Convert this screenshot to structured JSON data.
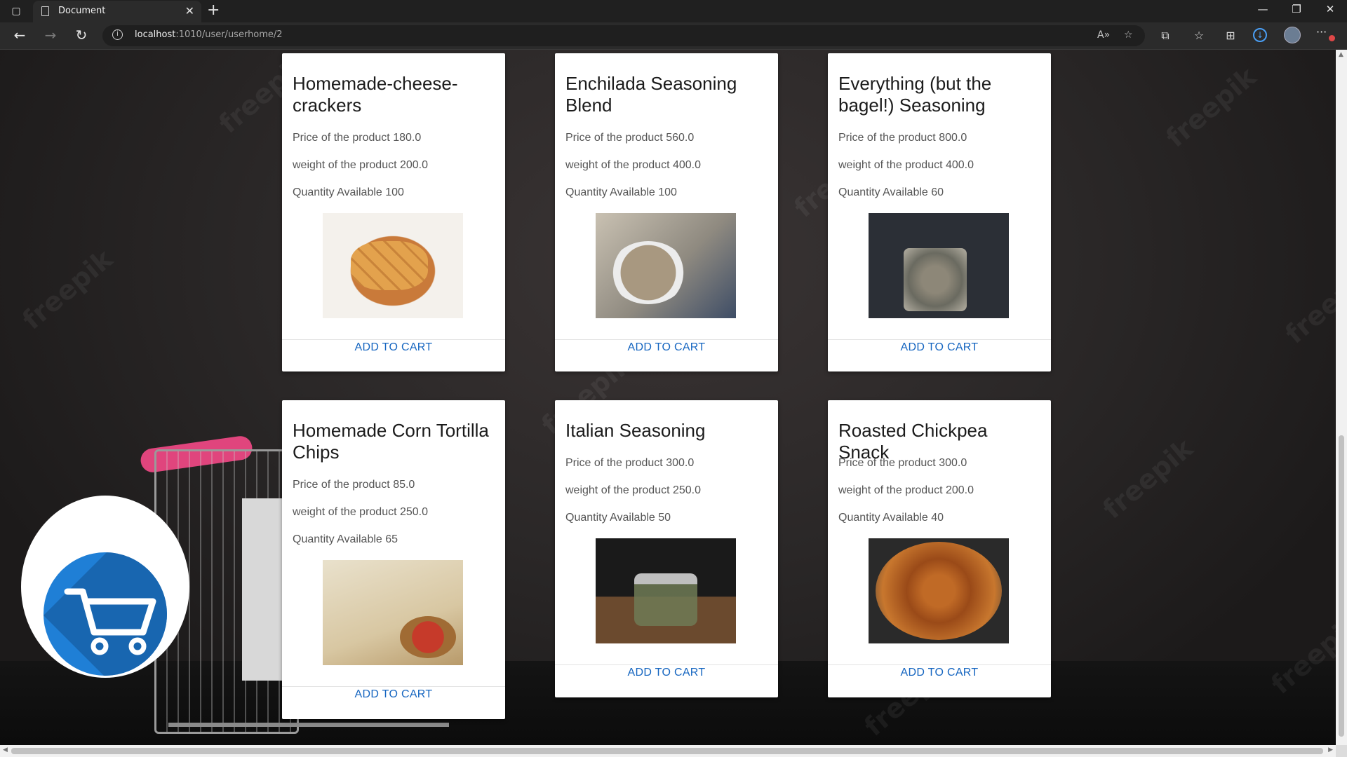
{
  "browser": {
    "tab_title": "Document",
    "url_host": "localhost",
    "url_rest": ":1010/user/userhome/2",
    "icons": {
      "tab_actions": "tab-actions-icon",
      "page": "page-icon",
      "close_tab": "close-icon",
      "new_tab": "plus-icon",
      "back": "back-arrow-icon",
      "forward": "forward-arrow-icon",
      "refresh": "refresh-icon",
      "site_info": "info-icon",
      "read_aloud": "read-aloud-icon",
      "add_favorite": "add-favorite-icon",
      "extensions": "puzzle-icon",
      "favorites": "favorites-icon",
      "collections": "collections-icon",
      "downloads": "download-icon",
      "profile": "avatar",
      "more": "ellipsis-icon"
    }
  },
  "products": [
    {
      "name": "Homemade-cheese-crackers",
      "price": "Price of the product 180.0",
      "weight": "weight of the product 200.0",
      "quantity": "Quantity Available 100",
      "image": "cheese-crackers-photo",
      "action": "ADD TO CART"
    },
    {
      "name": "Enchilada Seasoning Blend",
      "price": "Price of the product 560.0",
      "weight": "weight of the product 400.0",
      "quantity": "Quantity Available 100",
      "image": "enchilada-seasoning-photo",
      "action": "ADD TO CART"
    },
    {
      "name": "Everything (but the bagel!) Seasoning",
      "price": "Price of the product 800.0",
      "weight": "weight of the product 400.0",
      "quantity": "Quantity Available 60",
      "image": "bagel-seasoning-photo",
      "action": "ADD TO CART"
    },
    {
      "name": "Homemade Corn Tortilla Chips",
      "price": "Price of the product 85.0",
      "weight": "weight of the product 250.0",
      "quantity": "Quantity Available 65",
      "image": "tortilla-chips-photo",
      "action": "ADD TO CART"
    },
    {
      "name": "Italian Seasoning",
      "price": "Price of the product 300.0",
      "weight": "weight of the product 250.0",
      "quantity": "Quantity Available 50",
      "image": "italian-seasoning-photo",
      "action": "ADD TO CART"
    },
    {
      "name": "Roasted Chickpea Snack",
      "price": "Price of the product 300.0",
      "weight": "weight of the product 200.0",
      "quantity": "Quantity Available 40",
      "image": "chickpea-snack-photo",
      "action": "ADD TO CART"
    }
  ],
  "background": {
    "watermark": "freepik"
  },
  "floating_cart": {
    "icon": "shopping-cart-icon",
    "color": "#1f7fd6"
  },
  "colors": {
    "accent": "#1565c0",
    "card": "#ffffff"
  }
}
